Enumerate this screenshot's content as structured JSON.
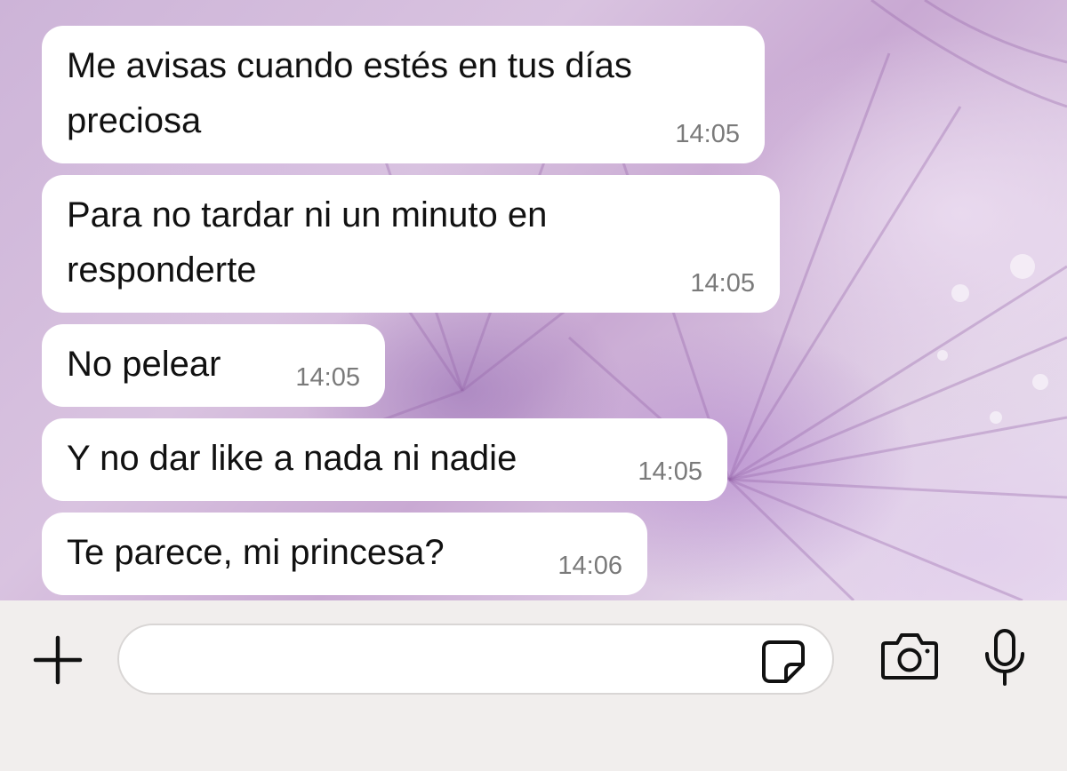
{
  "messages": [
    {
      "text_lines": [
        "Me avisas cuando estés en tus días",
        "preciosa"
      ],
      "time": "14:05"
    },
    {
      "text_lines": [
        "Para no tardar ni un minuto en",
        "responderte"
      ],
      "time": "14:05"
    },
    {
      "text_lines": [
        "No pelear"
      ],
      "time": "14:05"
    },
    {
      "text_lines": [
        "Y no dar like a nada ni nadie"
      ],
      "time": "14:05"
    },
    {
      "text_lines": [
        "Te parece, mi princesa?"
      ],
      "time": "14:06"
    }
  ],
  "input_bar": {
    "message_value": "",
    "message_placeholder": "",
    "icons": [
      "plus-icon",
      "sticker-icon",
      "camera-icon",
      "microphone-icon"
    ]
  },
  "colors": {
    "bubble": "#ffffff",
    "timestamp": "#7a7a7a",
    "input_bar": "#f1eeed",
    "wallpaper": "#d4bde0"
  }
}
